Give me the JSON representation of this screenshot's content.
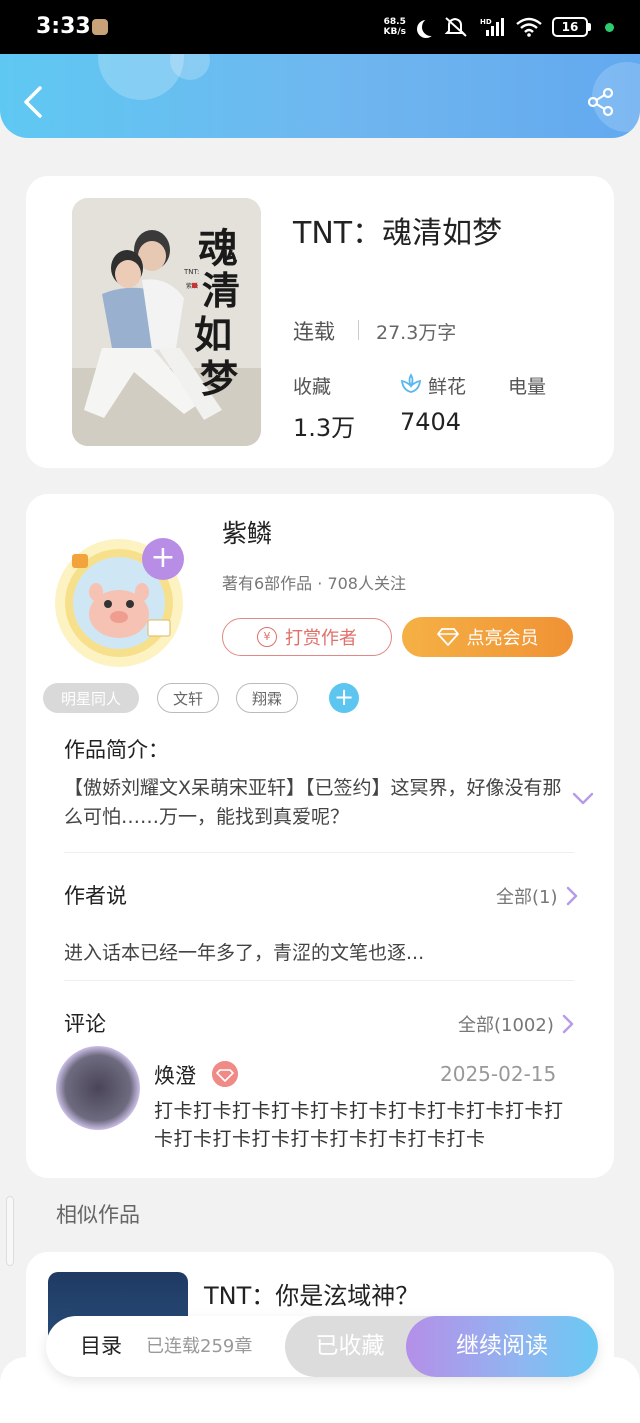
{
  "status_bar": {
    "time": "3:33",
    "net_speed_value": "68.5",
    "net_speed_unit": "KB/s",
    "network_label": "HD",
    "battery": "16"
  },
  "header": {
    "back_icon": "chevron-left-icon",
    "share_icon": "share-icon"
  },
  "book": {
    "title": "TNT：魂清如梦",
    "status": "连载",
    "word_count": "27.3万字",
    "stats": [
      {
        "label": "收藏",
        "value": "1.3万"
      },
      {
        "label": "鲜花",
        "value": "7404",
        "icon": "flower-icon"
      },
      {
        "label": "电量",
        "value": ""
      }
    ],
    "cover_text": "魂清如梦",
    "cover_small_text": "TNT:",
    "cover_author_text": "紫鳞"
  },
  "author": {
    "name": "紫鳞",
    "meta": "著有6部作品 · 708人关注",
    "tip_label": "打赏作者",
    "vip_label": "点亮会员",
    "follow_label": "+"
  },
  "tags": [
    "明星同人",
    "文轩",
    "翔霖"
  ],
  "synopsis": {
    "title": "作品简介：",
    "text": "【傲娇刘耀文X呆萌宋亚轩】【已签约】这冥界，好像没有那么可怕……万一，能找到真爱呢？"
  },
  "author_says": {
    "title": "作者说",
    "see_all": "全部(1)",
    "text": "进入话本已经一年多了，青涩的文笔也逐..."
  },
  "comments": {
    "title": "评论",
    "see_all": "全部(1002)",
    "items": [
      {
        "user": "焕澄",
        "date": "2025-02-15",
        "text": "打卡打卡打卡打卡打卡打卡打卡打卡打卡打卡打卡打卡打卡打卡打卡打卡打卡打卡打卡"
      }
    ]
  },
  "similar": {
    "title": "相似作品",
    "items": [
      {
        "title": "TNT：你是泫域神？"
      }
    ]
  },
  "bottom_bar": {
    "toc_label": "目录",
    "chapters_label": "已连载259章",
    "collected_label": "已收藏",
    "read_label": "继续阅读"
  },
  "colors": {
    "header_gradient_start": "#5fc8f2",
    "header_gradient_end": "#62a9ef",
    "vip_orange": "#f09235",
    "tip_red": "#e0706a",
    "accent_purple": "#b88de6",
    "accent_blue": "#5cc6f0"
  }
}
